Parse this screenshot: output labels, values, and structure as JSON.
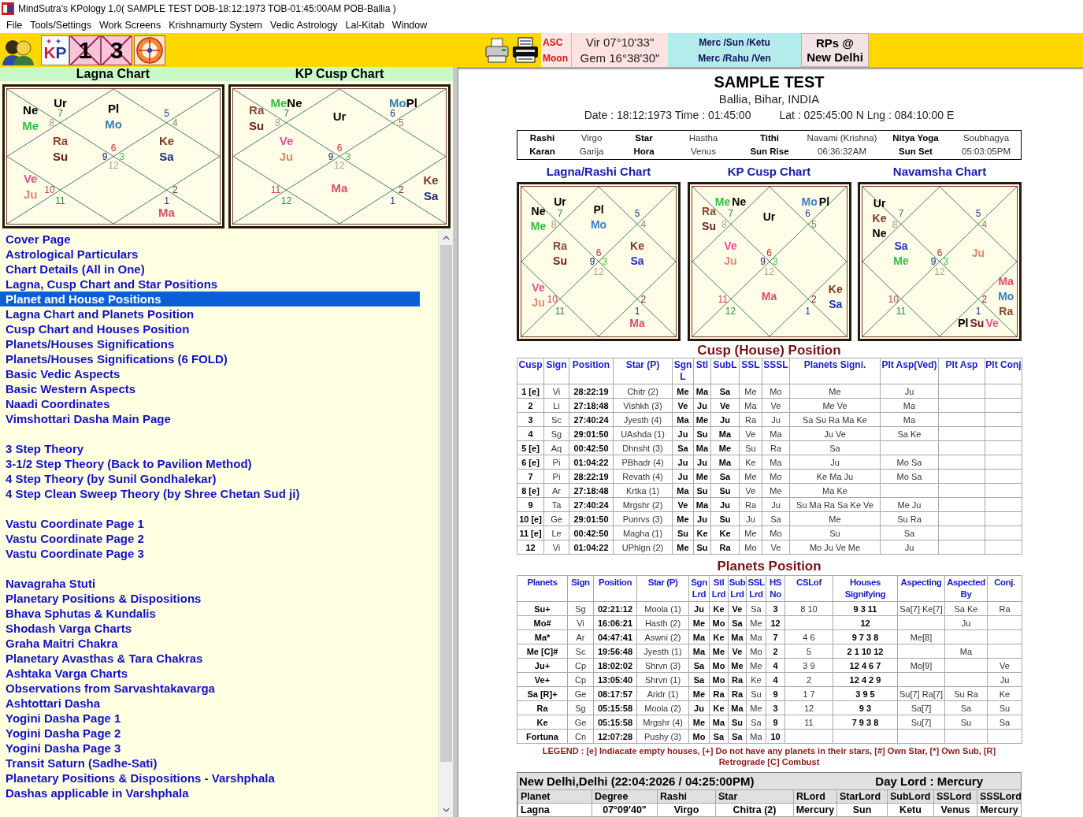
{
  "window": {
    "title": "MindSutra's KPology 1.0( SAMPLE TEST DOB-18:12:1973 TOB-01:45:00AM POB-Ballia )"
  },
  "menu": [
    "File",
    "Tools/Settings",
    "Work Screens",
    "Krishnamurty System",
    "Vedic Astrology",
    "Lal-Kitab",
    "Window"
  ],
  "toolbar": {
    "tools": [
      {
        "kind": "people"
      },
      {
        "kind": "logo",
        "text": "KP"
      },
      {
        "kind": "chart",
        "text": "1"
      },
      {
        "kind": "chart",
        "text": "3"
      },
      {
        "kind": "compass"
      }
    ],
    "print_tools": [
      {
        "kind": "printer"
      },
      {
        "kind": "printer_paper"
      }
    ],
    "positions": [
      {
        "label": "ASC",
        "value": "Vir 07°10'33\""
      },
      {
        "label": "Moon",
        "value": "Gem 16°38'30\""
      }
    ],
    "ruling_planets": [
      "Merc /Sun /Ketu",
      "Merc /Rahu /Ven"
    ],
    "rps_button": [
      "RPs @",
      "New Delhi"
    ]
  },
  "left_panel": {
    "charts": [
      {
        "title": "Lagna Chart",
        "houses": [
          {
            "kind": "third",
            "sign": "8",
            "planets": [
              [
                {
                  "name": "Ne",
                  "color": "#000000"
                }
              ],
              [
                {
                  "name": "Me",
                  "color": "#33bb44"
                }
              ]
            ]
          },
          {
            "kind": "second",
            "sign": "7",
            "planets": [
              [
                {
                  "name": "Ur",
                  "color": "#000000"
                }
              ]
            ]
          },
          {
            "kind": "first",
            "sign": "6",
            "planets": [
              [
                {
                  "name": "Pl",
                  "color": "#000000"
                }
              ],
              [
                {
                  "name": "Mo",
                  "color": "#3a7fa8"
                }
              ]
            ]
          },
          {
            "kind": "twelfth",
            "sign": "5"
          },
          {
            "kind": "eleventh",
            "sign": "4"
          },
          {
            "kind": "fourth",
            "sign": "9",
            "planets": [
              [
                {
                  "name": "Ra",
                  "color": "#8b4a2e"
                }
              ],
              [
                {
                  "name": "Su",
                  "color": "#6b1c1c"
                }
              ]
            ]
          },
          {
            "kind": "tenth",
            "sign": "3",
            "planets": [
              [
                {
                  "name": "Ke",
                  "color": "#7a3a22"
                }
              ],
              [
                {
                  "name": "Sa",
                  "color": "#1a2a80"
                }
              ]
            ]
          },
          {
            "kind": "seventh",
            "sign": "12"
          },
          {
            "kind": "fifth",
            "sign": "10",
            "planets": [
              [
                {
                  "name": "Ve",
                  "color": "#e8508c"
                }
              ],
              [
                {
                  "name": "Ju",
                  "color": "#d88a70"
                }
              ]
            ]
          },
          {
            "kind": "ninth",
            "sign": "2"
          },
          {
            "kind": "sixth",
            "sign": "11"
          },
          {
            "kind": "eighth",
            "sign": "1",
            "planets": [
              [
                {
                  "name": "Ma",
                  "color": "#d8506a"
                }
              ]
            ]
          }
        ]
      },
      {
        "title": "KP Cusp Chart",
        "houses": [
          {
            "kind": "third",
            "sign": "8",
            "planets": [
              [
                {
                  "name": "Ra",
                  "color": "#8b4a2e"
                }
              ],
              [
                {
                  "name": "Su",
                  "color": "#6b1c1c"
                }
              ]
            ]
          },
          {
            "kind": "second",
            "sign": "7",
            "planets": [
              [
                {
                  "name": "Me",
                  "color": "#33bb44"
                },
                {
                  "name": "Ne",
                  "color": "#000000"
                }
              ]
            ]
          },
          {
            "kind": "first",
            "sign": "6",
            "planets": [
              [
                {
                  "name": "Ur",
                  "color": "#000000"
                }
              ]
            ]
          },
          {
            "kind": "twelfth",
            "sign": "6",
            "planets": [
              [
                {
                  "name": "Mo",
                  "color": "#3a7fa8"
                },
                {
                  "name": "Pl",
                  "color": "#000000"
                }
              ]
            ]
          },
          {
            "kind": "eleventh",
            "sign": "5"
          },
          {
            "kind": "fourth",
            "sign": "9",
            "planets": [
              [
                {
                  "name": "Ve",
                  "color": "#e8508c"
                }
              ],
              [
                {
                  "name": "Ju",
                  "color": "#d88a70"
                }
              ]
            ]
          },
          {
            "kind": "tenth",
            "sign": "3"
          },
          {
            "kind": "fifth",
            "sign": "11"
          },
          {
            "kind": "seventh",
            "sign": "12",
            "planets": [
              [
                {
                  "name": "Ma",
                  "color": "#d8506a"
                }
              ]
            ]
          },
          {
            "kind": "sixth",
            "sign": "12"
          },
          {
            "kind": "eighth",
            "sign": "1"
          },
          {
            "kind": "ninth",
            "sign": "2",
            "planets": [
              [
                {
                  "name": "Ke",
                  "color": "#7a3a22"
                }
              ],
              [
                {
                  "name": "Sa",
                  "color": "#1a2a80"
                }
              ]
            ]
          }
        ]
      }
    ],
    "pages": [
      [
        {
          "label": "Cover Page",
          "selected": false
        },
        {
          "label": "Astrological Particulars",
          "selected": false
        },
        {
          "label": "Chart Details (All in One)",
          "selected": false
        },
        {
          "label": "Lagna, Cusp Chart and Star Positions",
          "selected": false
        },
        {
          "label": "Planet and House Positions",
          "selected": true
        },
        {
          "label": "Lagna Chart and Planets Position",
          "selected": false
        },
        {
          "label": "Cusp Chart and Houses Position",
          "selected": false
        },
        {
          "label": "Planets/Houses Significations",
          "selected": false
        },
        {
          "label": "Planets/Houses Significations (6 FOLD)",
          "selected": false
        },
        {
          "label": "Basic Vedic Aspects",
          "selected": false
        },
        {
          "label": "Basic Western Aspects",
          "selected": false
        },
        {
          "label": "Naadi Coordinates",
          "selected": false
        },
        {
          "label": "Vimshottari Dasha Main Page",
          "selected": false
        }
      ],
      [
        {
          "label": "3 Step Theory",
          "selected": false
        },
        {
          "label": "3-1/2 Step Theory (Back to Pavilion Method)",
          "selected": false
        },
        {
          "label": "4 Step Theory (by Sunil Gondhalekar)",
          "selected": false
        },
        {
          "label": "4 Step Clean Sweep Theory (by Shree Chetan Sud ji)",
          "selected": false
        }
      ],
      [
        {
          "label": "Vastu Coordinate Page 1",
          "selected": false
        },
        {
          "label": "Vastu Coordinate Page 2",
          "selected": false
        },
        {
          "label": "Vastu Coordinate Page 3",
          "selected": false
        }
      ],
      [
        {
          "label": "Navagraha Stuti",
          "selected": false
        },
        {
          "label": "Planetary Positions & Dispositions",
          "selected": false
        },
        {
          "label": "Bhava Sphutas & Kundalis",
          "selected": false
        },
        {
          "label": "Shodash Varga Charts",
          "selected": false
        },
        {
          "label": "Graha Maitri Chakra",
          "selected": false
        },
        {
          "label": "Planetary Avasthas & Tara Chakras",
          "selected": false
        },
        {
          "label": "Ashtaka Varga Charts",
          "selected": false
        },
        {
          "label": "Observations from Sarvashtakavarga",
          "selected": false
        },
        {
          "label": "Ashtottari Dasha",
          "selected": false
        },
        {
          "label": "Yogini Dasha Page 1",
          "selected": false
        },
        {
          "label": "Yogini Dasha Page 2",
          "selected": false
        },
        {
          "label": "Yogini Dasha Page 3",
          "selected": false
        },
        {
          "label": "Transit Saturn (Sadhe-Sati)",
          "selected": false
        },
        {
          "label": "Planetary Positions & Dispositions - Varshphala",
          "selected": false
        },
        {
          "label": "Dashas applicable in Varshphala",
          "selected": false
        }
      ]
    ]
  },
  "report": {
    "name": "SAMPLE TEST",
    "place": "Ballia, Bihar, INDIA",
    "birth_line": "Date : 18:12:1973 Time : 01:45:00",
    "coords_line": "Lat : 025:45:00 N Lng : 084:10:00 E",
    "panchang": [
      {
        "label": "Rashi",
        "value": "Virgo"
      },
      {
        "label": "Star",
        "value": "Hastha"
      },
      {
        "label": "Tithi",
        "value": "Navami (Krishna)"
      },
      {
        "label": "Nitya Yoga",
        "value": "Soubhagya"
      },
      {
        "label": "Karan",
        "value": "Garija"
      },
      {
        "label": "Hora",
        "value": "Venus"
      },
      {
        "label": "Sun Rise",
        "value": "06:36:32AM"
      },
      {
        "label": "Sun Set",
        "value": "05:03:05PM"
      }
    ],
    "charts": [
      {
        "title": "Lagna/Rashi Chart",
        "houses": [
          {
            "kind": "third",
            "sign": "8",
            "planets": [
              [
                {
                  "name": "Ne",
                  "color": "#000000"
                }
              ],
              [
                {
                  "name": "Me",
                  "color": "#33bb44"
                }
              ]
            ]
          },
          {
            "kind": "second",
            "sign": "7",
            "planets": [
              [
                {
                  "name": "Ur",
                  "color": "#000000"
                }
              ]
            ]
          },
          {
            "kind": "first",
            "sign": "6",
            "planets": [
              [
                {
                  "name": "Pl",
                  "color": "#000000"
                }
              ],
              [
                {
                  "name": "Mo",
                  "color": "#3a80c0"
                }
              ]
            ]
          },
          {
            "kind": "twelfth",
            "sign": "5"
          },
          {
            "kind": "eleventh",
            "sign": "4"
          },
          {
            "kind": "fourth",
            "sign": "9",
            "planets": [
              [
                {
                  "name": "Ra",
                  "color": "#8b4a2e"
                }
              ],
              [
                {
                  "name": "Su",
                  "color": "#6b1c1c"
                }
              ]
            ]
          },
          {
            "kind": "tenth",
            "sign": "3",
            "planets": [
              [
                {
                  "name": "Ke",
                  "color": "#7a3a22"
                }
              ],
              [
                {
                  "name": "Sa",
                  "color": "#2030c0"
                }
              ]
            ]
          },
          {
            "kind": "seventh",
            "sign": "12"
          },
          {
            "kind": "fifth",
            "sign": "10",
            "planets": [
              [
                {
                  "name": "Ve",
                  "color": "#e8508c"
                }
              ],
              [
                {
                  "name": "Ju",
                  "color": "#d88a70"
                }
              ]
            ]
          },
          {
            "kind": "ninth",
            "sign": "2"
          },
          {
            "kind": "sixth",
            "sign": "11"
          },
          {
            "kind": "eighth",
            "sign": "1",
            "planets": [
              [
                {
                  "name": "Ma",
                  "color": "#d8506a"
                }
              ]
            ]
          }
        ]
      },
      {
        "title": "KP Cusp Chart",
        "houses": [
          {
            "kind": "third",
            "sign": "8",
            "planets": [
              [
                {
                  "name": "Ra",
                  "color": "#8b4a2e"
                }
              ],
              [
                {
                  "name": "Su",
                  "color": "#6b1c1c"
                }
              ]
            ]
          },
          {
            "kind": "second",
            "sign": "7",
            "planets": [
              [
                {
                  "name": "Me",
                  "color": "#33bb44"
                },
                {
                  "name": "Ne",
                  "color": "#000000"
                }
              ]
            ]
          },
          {
            "kind": "first",
            "sign": "6",
            "planets": [
              [
                {
                  "name": "Ur",
                  "color": "#000000"
                }
              ]
            ]
          },
          {
            "kind": "twelfth",
            "sign": "6",
            "planets": [
              [
                {
                  "name": "Mo",
                  "color": "#3a80c0"
                },
                {
                  "name": "Pl",
                  "color": "#000000"
                }
              ]
            ]
          },
          {
            "kind": "eleventh",
            "sign": "5"
          },
          {
            "kind": "fourth",
            "sign": "9",
            "planets": [
              [
                {
                  "name": "Ve",
                  "color": "#e8508c"
                }
              ],
              [
                {
                  "name": "Ju",
                  "color": "#d88a70"
                }
              ]
            ]
          },
          {
            "kind": "tenth",
            "sign": "3"
          },
          {
            "kind": "fifth",
            "sign": "11"
          },
          {
            "kind": "seventh",
            "sign": "12",
            "planets": [
              [
                {
                  "name": "Ma",
                  "color": "#d8506a"
                }
              ]
            ]
          },
          {
            "kind": "sixth",
            "sign": "12"
          },
          {
            "kind": "eighth",
            "sign": "1"
          },
          {
            "kind": "ninth",
            "sign": "2",
            "planets": [
              [
                {
                  "name": "Ke",
                  "color": "#7a3a22"
                }
              ],
              [
                {
                  "name": "Sa",
                  "color": "#2030c0"
                }
              ]
            ]
          }
        ]
      },
      {
        "title": "Navamsha Chart",
        "houses": [
          {
            "kind": "third",
            "sign": "8",
            "planets": [
              [
                {
                  "name": "Ur",
                  "color": "#000000"
                }
              ],
              [
                {
                  "name": "Ke",
                  "color": "#7a3a22"
                }
              ],
              [
                {
                  "name": "Ne",
                  "color": "#000000"
                }
              ]
            ]
          },
          {
            "kind": "second",
            "sign": "7"
          },
          {
            "kind": "twelfth",
            "sign": "5"
          },
          {
            "kind": "eleventh",
            "sign": "4"
          },
          {
            "kind": "fourth",
            "sign": "9",
            "planets": [
              [
                {
                  "name": "Sa",
                  "color": "#2030c0"
                }
              ],
              [
                {
                  "name": "Me",
                  "color": "#33bb44"
                }
              ]
            ]
          },
          {
            "kind": "first",
            "sign": "6"
          },
          {
            "kind": "tenth",
            "sign": "3",
            "planets": [
              [
                {
                  "name": "Ju",
                  "color": "#d88a70"
                }
              ]
            ]
          },
          {
            "kind": "seventh",
            "sign": "12"
          },
          {
            "kind": "fifth",
            "sign": "10"
          },
          {
            "kind": "sixth",
            "sign": "11"
          },
          {
            "kind": "eighth",
            "sign": "1",
            "planets": [
              [
                {
                  "name": "Pl",
                  "color": "#000000"
                },
                {
                  "name": "Su",
                  "color": "#6b1c1c"
                },
                {
                  "name": "Ve",
                  "color": "#e8508c"
                }
              ]
            ]
          },
          {
            "kind": "ninth",
            "sign": "2",
            "planets": [
              [
                {
                  "name": "Ma",
                  "color": "#d8506a"
                }
              ],
              [
                {
                  "name": "Mo",
                  "color": "#3a80c0"
                }
              ],
              [
                {
                  "name": "Ra",
                  "color": "#8b4a2e"
                }
              ]
            ]
          }
        ]
      }
    ],
    "cusp_table": {
      "title": "Cusp (House) Position",
      "columns": [
        "Cusp",
        "Sign",
        "Position",
        "Star (P)",
        "Sgn L",
        "Stl",
        "SubL",
        "SSL",
        "SSSL",
        "Planets Signi.",
        "Plt Asp(Ved)",
        "Plt Asp",
        "Plt Conj"
      ],
      "rows": [
        [
          "1 [e]",
          "Vi",
          "28:22:19",
          "Chitr (2)",
          "Me",
          "Ma",
          "Sa",
          "Me",
          "Mo",
          "Me",
          "Ju"
        ],
        [
          "2",
          "Li",
          "27:18:48",
          "Vishkh (3)",
          "Ve",
          "Ju",
          "Ve",
          "Ma",
          "Ve",
          "Me Ve",
          "Ma"
        ],
        [
          "3",
          "Sc",
          "27:40:24",
          "Jyesth (4)",
          "Ma",
          "Me",
          "Ju",
          "Ra",
          "Ju",
          "Sa Su Ra Ma Ke",
          "Ma"
        ],
        [
          "4",
          "Sg",
          "29:01:50",
          "UAshda (1)",
          "Ju",
          "Su",
          "Ma",
          "Ve",
          "Ma",
          "Ju Ve",
          "Sa Ke"
        ],
        [
          "5 [e]",
          "Aq",
          "00:42:50",
          "Dhnsht (3)",
          "Sa",
          "Ma",
          "Me",
          "Su",
          "Ra",
          "Sa"
        ],
        [
          "6 [e]",
          "Pi",
          "01:04:22",
          "PBhadr (4)",
          "Ju",
          "Ju",
          "Ma",
          "Ke",
          "Ma",
          "Ju",
          "Mo Sa"
        ],
        [
          "7",
          "Pi",
          "28:22:19",
          "Revath (4)",
          "Ju",
          "Me",
          "Sa",
          "Me",
          "Mo",
          "Ke Ma Ju",
          "Mo Sa"
        ],
        [
          "8 [e]",
          "Ar",
          "27:18:48",
          "Krtka (1)",
          "Ma",
          "Su",
          "Su",
          "Ve",
          "Me",
          "Ma Ke"
        ],
        [
          "9",
          "Ta",
          "27:40:24",
          "Mrgshr (2)",
          "Ve",
          "Ma",
          "Ju",
          "Ra",
          "Ju",
          "Su Ma Ra Sa Ke Ve",
          "Me Ju"
        ],
        [
          "10 [e]",
          "Ge",
          "29:01:50",
          "Punrvs (3)",
          "Me",
          "Ju",
          "Su",
          "Ju",
          "Sa",
          "Me",
          "Su Ra"
        ],
        [
          "11 [e]",
          "Le",
          "00:42:50",
          "Magha (1)",
          "Su",
          "Ke",
          "Ke",
          "Me",
          "Mo",
          "Su",
          "Sa"
        ],
        [
          "12",
          "Vi",
          "01:04:22",
          "UPhlgn (2)",
          "Me",
          "Su",
          "Ra",
          "Mo",
          "Ve",
          "Mo Ju Ve Me",
          "Ju"
        ]
      ]
    },
    "planets_table": {
      "title": "Planets Position",
      "columns": [
        "Planets",
        "Sign",
        "Position",
        "Star (P)",
        "Sgn Lrd",
        "Stl Lrd",
        "Sub Lrd",
        "SSL Lrd",
        "HS No",
        "CSLof",
        "Houses Signifying",
        "Aspecting",
        "Aspected By",
        "Conj."
      ],
      "rows": [
        [
          "Su+",
          "Sg",
          "02:21:12",
          "Moola (1)",
          "Ju",
          "Ke",
          "Ve",
          "Sa",
          "3",
          "8 10",
          "9 3 11",
          "Sa[7] Ke[7]",
          "Sa Ke",
          "Ra"
        ],
        [
          "Mo#",
          "Vi",
          "16:06:21",
          "Hasth (2)",
          "Me",
          "Mo",
          "Sa",
          "Me",
          "12",
          null,
          "12",
          null,
          "Ju"
        ],
        [
          "Ma*",
          "Ar",
          "04:47:41",
          "Aswni (2)",
          "Ma",
          "Ke",
          "Ma",
          "Ma",
          "7",
          "4 6",
          "9 7 3 8",
          "Me[8]"
        ],
        [
          "Me [C]#",
          "Sc",
          "19:56:48",
          "Jyesth (1)",
          "Ma",
          "Me",
          "Ve",
          "Mo",
          "2",
          "5",
          "2 1 10 12",
          null,
          "Ma"
        ],
        [
          "Ju+",
          "Cp",
          "18:02:02",
          "Shrvn (3)",
          "Sa",
          "Mo",
          "Me",
          "Me",
          "4",
          "3 9",
          "12 4 6 7",
          "Mo[9]",
          null,
          "Ve"
        ],
        [
          "Ve+",
          "Cp",
          "13:05:40",
          "Shrvn (1)",
          "Sa",
          "Mo",
          "Ra",
          "Ke",
          "4",
          "2",
          "12 4 2 9",
          null,
          null,
          "Ju"
        ],
        [
          "Sa [R]+",
          "Ge",
          "08:17:57",
          "Aridr (1)",
          "Me",
          "Ra",
          "Ra",
          "Su",
          "9",
          "1 7",
          "3 9 5",
          "Su[7] Ra[7]",
          "Su Ra",
          "Ke"
        ],
        [
          "Ra",
          "Sg",
          "05:15:58",
          "Moola (2)",
          "Ju",
          "Ke",
          "Ma",
          "Me",
          "3",
          "12",
          "9 3",
          "Sa[7]",
          "Sa",
          "Su"
        ],
        [
          "Ke",
          "Ge",
          "05:15:58",
          "Mrgshr (4)",
          "Me",
          "Ma",
          "Su",
          "Sa",
          "9",
          "11",
          "7 9 3 8",
          "Su[7]",
          "Su",
          "Sa"
        ],
        [
          "Fortuna",
          "Cn",
          "12:07:28",
          "Pushy (3)",
          "Mo",
          "Sa",
          "Sa",
          "Ma",
          "10"
        ]
      ]
    },
    "legend": "LEGEND : [e] Indiacate empty houses, [+] Do not have any planets in their stars, [#] Own Star, [*] Own Sub, [R] Retrograde [C] Combust",
    "transit": {
      "title": "New Delhi,Delhi (22:04:2026 / 04:25:00PM)",
      "day_lord": "Day Lord : Mercury",
      "columns": [
        "Planet",
        "Degree",
        "Rashi",
        "Star",
        "RLord",
        "StarLord",
        "SubLord",
        "SSLord",
        "SSSLord"
      ],
      "rows": [
        [
          "Lagna",
          "07°09'40\"",
          "Virgo",
          "Chitra (2)",
          "Mercury",
          "Sun",
          "Ketu",
          "Venus",
          "Mercury"
        ]
      ]
    }
  }
}
